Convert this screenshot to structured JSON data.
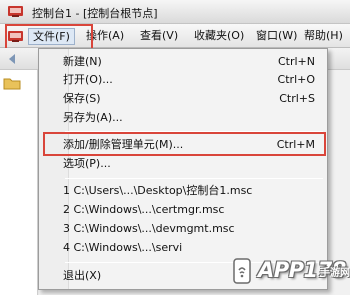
{
  "window": {
    "title": "控制台1 - [控制台根节点]",
    "icon": "mmc-console-icon"
  },
  "menubar": {
    "items": [
      {
        "label": "文件(F)",
        "active": true
      },
      {
        "label": "操作(A)",
        "active": false
      },
      {
        "label": "查看(V)",
        "active": false
      },
      {
        "label": "收藏夹(O)",
        "active": false
      },
      {
        "label": "窗口(W)",
        "active": false
      },
      {
        "label": "帮助(H)",
        "active": false
      }
    ]
  },
  "file_menu": {
    "items": [
      {
        "label": "新建(N)",
        "shortcut": "Ctrl+N"
      },
      {
        "label": "打开(O)...",
        "shortcut": "Ctrl+O"
      },
      {
        "label": "保存(S)",
        "shortcut": "Ctrl+S"
      },
      {
        "label": "另存为(A)...",
        "shortcut": ""
      },
      {
        "label": "添加/删除管理单元(M)...",
        "shortcut": "Ctrl+M"
      },
      {
        "label": "选项(P)...",
        "shortcut": ""
      },
      {
        "label": "1 C:\\Users\\...\\Desktop\\控制台1.msc",
        "shortcut": ""
      },
      {
        "label": "2 C:\\Windows\\...\\certmgr.msc",
        "shortcut": ""
      },
      {
        "label": "3 C:\\Windows\\...\\devmgmt.msc",
        "shortcut": ""
      },
      {
        "label": "4 C:\\Windows\\...\\servi",
        "shortcut": ""
      },
      {
        "label": "退出(X)",
        "shortcut": ""
      }
    ]
  },
  "watermark": {
    "brand": "APP178",
    "sub": "手游网"
  },
  "colors": {
    "highlight": "#d9453a",
    "menu_bg": "#f3f3f3"
  }
}
